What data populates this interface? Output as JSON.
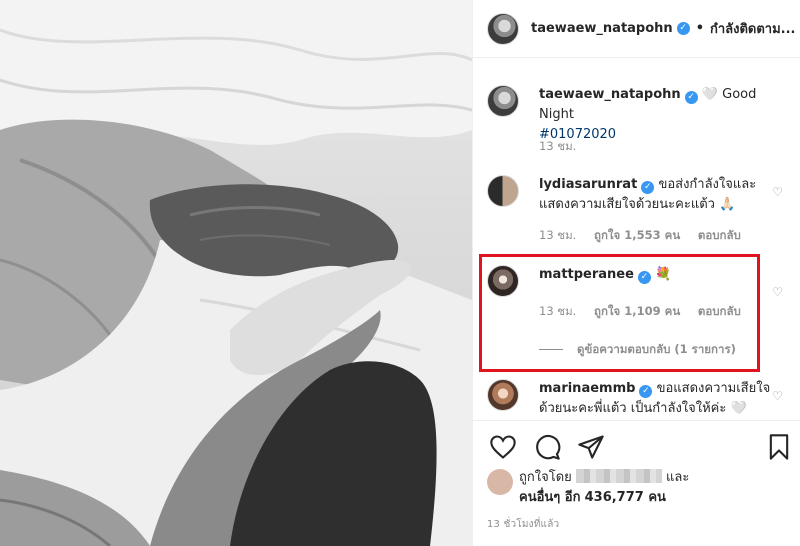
{
  "header": {
    "username": "taewaew_natapohn",
    "separator": "•",
    "follow_label": "กำลังติดตาม..."
  },
  "caption": {
    "username": "taewaew_natapohn",
    "text": "🤍 Good Night",
    "hashtag": "#01072020",
    "time": "13 ชม."
  },
  "comments": [
    {
      "username": "lydiasarunrat",
      "text": "ขอส่งกำลังใจและแสดงความเสียใจด้วยนะคะแต้ว 🙏🏻",
      "time": "13 ชม.",
      "likes": "ถูกใจ 1,553 คน",
      "reply": "ตอบกลับ"
    },
    {
      "username": "mattperanee",
      "text": "💐",
      "time": "13 ชม.",
      "likes": "ถูกใจ 1,109 คน",
      "reply": "ตอบกลับ",
      "view_replies": "ดูข้อความตอบกลับ (1 รายการ)"
    },
    {
      "username": "marinaemmb",
      "text": "ขอแสดงความเสียใจด้วยนะคะพี่แต้ว เป็นกำลังใจให้ค่ะ 🤍"
    }
  ],
  "icons": {
    "like": "heart-icon",
    "comment": "comment-icon",
    "share": "share-icon",
    "save": "bookmark-icon"
  },
  "likes": {
    "prefix": "ถูกใจโดย",
    "and": "และ",
    "others_prefix": "คนอื่นๆ อีก",
    "count": "436,777 คน"
  },
  "timestamp": "13 ชั่วโมงที่แล้ว",
  "colors": {
    "verified": "#3897f0",
    "highlight": "#e0141e",
    "hashtag": "#00376b"
  }
}
